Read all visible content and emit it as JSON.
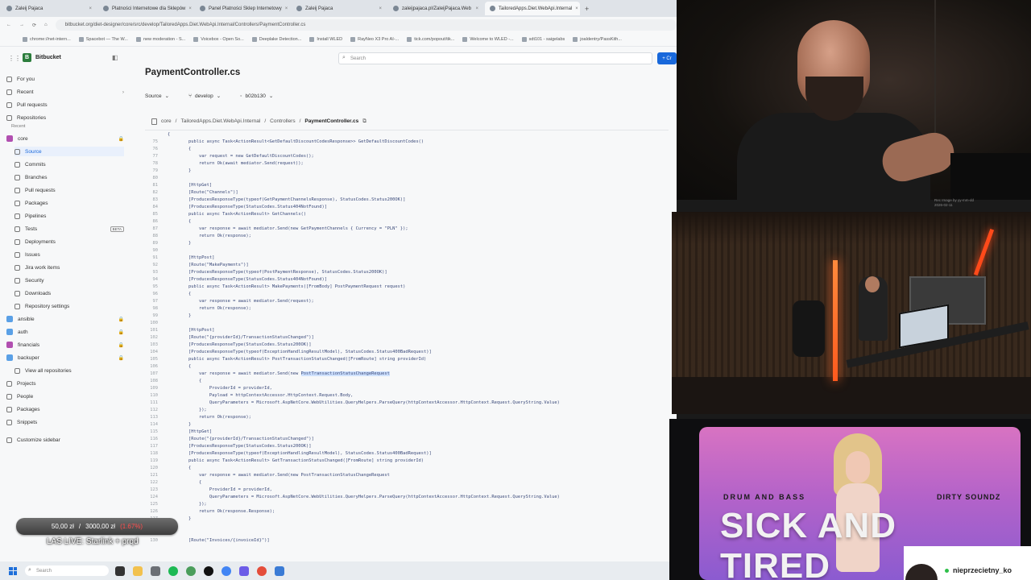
{
  "browser": {
    "tabs": [
      {
        "label": "Zaleij Pajaca"
      },
      {
        "label": "Platności Internetowe dla Sklepów"
      },
      {
        "label": "Panel Platności Sklep Internetowy"
      },
      {
        "label": "Zaleij Pajaca"
      },
      {
        "label": "zaleijpajaca.pl/ZaleijPajaca.Web"
      },
      {
        "label": "TailoredApps.Diet.WebApi.Internal"
      }
    ],
    "new_tab": "+",
    "url": "bitbucket.org/diet-designer/core/src/develop/TailoredApps.Diet.WebApi.Internal/Controllers/PaymentController.cs",
    "bookmarks": [
      "chrome://net-intern...",
      "Spacebot — The W...",
      "new moderation - S...",
      "Voicebox - Open So...",
      "Deeplake Detection...",
      "Install WLED",
      "RayNeo X3 Pro AI-...",
      "tick.com/popout/tik...",
      "Welcome to WLED -...",
      "sdt101 - saigelabs",
      "joaldentry/PassKith..."
    ]
  },
  "app": {
    "name": "Bitbucket",
    "search_placeholder": "Search",
    "create_label": "+ Cr"
  },
  "sidebar": {
    "items": [
      {
        "label": "For you"
      },
      {
        "label": "Recent",
        "chevron": "›"
      },
      {
        "label": "Pull requests"
      },
      {
        "label": "Repositories"
      }
    ],
    "recent_heading": "Recent",
    "repo_current": "core",
    "repo_sub": [
      {
        "label": "Source"
      },
      {
        "label": "Commits"
      },
      {
        "label": "Branches"
      },
      {
        "label": "Pull requests"
      },
      {
        "label": "Packages"
      },
      {
        "label": "Pipelines"
      },
      {
        "label": "Tests",
        "badge": "BETA"
      },
      {
        "label": "Deployments"
      },
      {
        "label": "Issues"
      },
      {
        "label": "Jira work items"
      },
      {
        "label": "Security"
      },
      {
        "label": "Downloads"
      },
      {
        "label": "Repository settings"
      }
    ],
    "other_repos": [
      {
        "label": "ansible",
        "color": "#5aa0e6"
      },
      {
        "label": "auth",
        "color": "#5aa0e6"
      },
      {
        "label": "financials",
        "color": "#b14fb0"
      },
      {
        "label": "backuper",
        "color": "#5aa0e6"
      }
    ],
    "view_all": "View all repositories",
    "bottom": [
      {
        "label": "Projects"
      },
      {
        "label": "People"
      },
      {
        "label": "Packages"
      },
      {
        "label": "Snippets"
      }
    ],
    "customize": "Customize sidebar"
  },
  "main": {
    "title": "PaymentController.cs",
    "source_label": "Source",
    "branch_label": "develop",
    "commit_label": "b02b130",
    "breadcrumb": [
      "core",
      "TailoredApps.Diet.WebApi.Internal",
      "Controllers",
      "PaymentController.cs"
    ]
  },
  "code_lines": [
    {
      "n": "",
      "t": "{"
    },
    {
      "n": "75",
      "t": "        public async Task<ActionResult<GetDefaultDiscountCodesResponse>> GetDefaultDiscountCodes()"
    },
    {
      "n": "76",
      "t": "        {"
    },
    {
      "n": "77",
      "t": "            var request = new GetDefaultDiscountCodes();"
    },
    {
      "n": "78",
      "t": "            return Ok(await mediator.Send(request));"
    },
    {
      "n": "79",
      "t": "        }"
    },
    {
      "n": "80",
      "t": ""
    },
    {
      "n": "81",
      "t": "        [HttpGet]"
    },
    {
      "n": "82",
      "t": "        [Route(\"Channels\")]"
    },
    {
      "n": "83",
      "t": "        [ProducesResponseType(typeof(GetPaymentChannelsResponse), StatusCodes.Status200OK)]"
    },
    {
      "n": "84",
      "t": "        [ProducesResponseType(StatusCodes.Status404NotFound)]"
    },
    {
      "n": "85",
      "t": "        public async Task<ActionResult> GetChannels()"
    },
    {
      "n": "86",
      "t": "        {"
    },
    {
      "n": "87",
      "t": "            var response = await mediator.Send(new GetPaymentChannels { Currency = \"PLN\" });"
    },
    {
      "n": "88",
      "t": "            return Ok(response);"
    },
    {
      "n": "89",
      "t": "        }"
    },
    {
      "n": "90",
      "t": ""
    },
    {
      "n": "91",
      "t": "        [HttpPost]"
    },
    {
      "n": "92",
      "t": "        [Route(\"MakePayments\")]"
    },
    {
      "n": "93",
      "t": "        [ProducesResponseType(typeof(PostPaymentResponse), StatusCodes.Status200OK)]"
    },
    {
      "n": "94",
      "t": "        [ProducesResponseType(StatusCodes.Status404NotFound)]"
    },
    {
      "n": "95",
      "t": "        public async Task<ActionResult> MakePayments([FromBody] PostPaymentRequest request)"
    },
    {
      "n": "96",
      "t": "        {"
    },
    {
      "n": "97",
      "t": "            var response = await mediator.Send(request);"
    },
    {
      "n": "98",
      "t": "            return Ok(response);"
    },
    {
      "n": "99",
      "t": "        }"
    },
    {
      "n": "100",
      "t": ""
    },
    {
      "n": "101",
      "t": "        [HttpPost]"
    },
    {
      "n": "102",
      "t": "        [Route(\"{providerId}/TransactionStatusChanged\")]"
    },
    {
      "n": "103",
      "t": "        [ProducesResponseType(StatusCodes.Status200OK)]"
    },
    {
      "n": "104",
      "t": "        [ProducesResponseType(typeof(ExceptionHandlingResultModel), StatusCodes.Status400BadRequest)]"
    },
    {
      "n": "105",
      "t": "        public async Task<ActionResult> PostTransactionStatusChanged([FromRoute] string providerId)"
    },
    {
      "n": "106",
      "t": "        {"
    },
    {
      "n": "107",
      "t": "            var response = await mediator.Send(new PostTransactionStatusChangeRequest",
      "hl": "PostTransactionStatusChangeRequest"
    },
    {
      "n": "108",
      "t": "            {"
    },
    {
      "n": "109",
      "t": "                ProviderId = providerId,"
    },
    {
      "n": "110",
      "t": "                Payload = httpContextAccessor.HttpContext.Request.Body,"
    },
    {
      "n": "111",
      "t": "                QueryParameters = Microsoft.AspNetCore.WebUtilities.QueryHelpers.ParseQuery(httpContextAccessor.HttpContext.Request.QueryString.Value)"
    },
    {
      "n": "112",
      "t": "            });"
    },
    {
      "n": "113",
      "t": "            return Ok(response);"
    },
    {
      "n": "114",
      "t": "        }"
    },
    {
      "n": "115",
      "t": "        [HttpGet]"
    },
    {
      "n": "116",
      "t": "        [Route(\"{providerId}/TransactionStatusChanged\")]"
    },
    {
      "n": "117",
      "t": "        [ProducesResponseType(StatusCodes.Status200OK)]"
    },
    {
      "n": "118",
      "t": "        [ProducesResponseType(typeof(ExceptionHandlingResultModel), StatusCodes.Status400BadRequest)]"
    },
    {
      "n": "119",
      "t": "        public async Task<ActionResult> GetTransactionStatusChanged([FromRoute] string providerId)"
    },
    {
      "n": "120",
      "t": "        {"
    },
    {
      "n": "121",
      "t": "            var response = await mediator.Send(new PostTransactionStatusChangeRequest"
    },
    {
      "n": "122",
      "t": "            {"
    },
    {
      "n": "123",
      "t": "                ProviderId = providerId,"
    },
    {
      "n": "124",
      "t": "                QueryParameters = Microsoft.AspNetCore.WebUtilities.QueryHelpers.ParseQuery(httpContextAccessor.HttpContext.Request.QueryString.Value)"
    },
    {
      "n": "125",
      "t": "            });"
    },
    {
      "n": "126",
      "t": "            return Ok(response.Response);"
    },
    {
      "n": "127",
      "t": "        }"
    },
    {
      "n": "128",
      "t": ""
    },
    {
      "n": "129",
      "t": ""
    },
    {
      "n": "130",
      "t": "        [Route(\"Invoices/{invoiceId}\")]"
    }
  ],
  "taskbar": {
    "search_placeholder": "Search"
  },
  "donation": {
    "current": "50,00 zł",
    "goal": "3000,00 zł",
    "percent": "(1.67%)",
    "progress_fraction": 0.0167
  },
  "stream_title": "LAS LIVE: Starlink + prqd",
  "cam_meta": {
    "line1": "Rec Image by yy-mm-dd",
    "line2": "2026-02-11"
  },
  "album": {
    "genre": "DRUM AND BASS",
    "artist": "DIRTY SOUNDZ",
    "title": "SICK AND TIRED"
  },
  "chat_user": {
    "name": "nieprzecietny_ko"
  }
}
